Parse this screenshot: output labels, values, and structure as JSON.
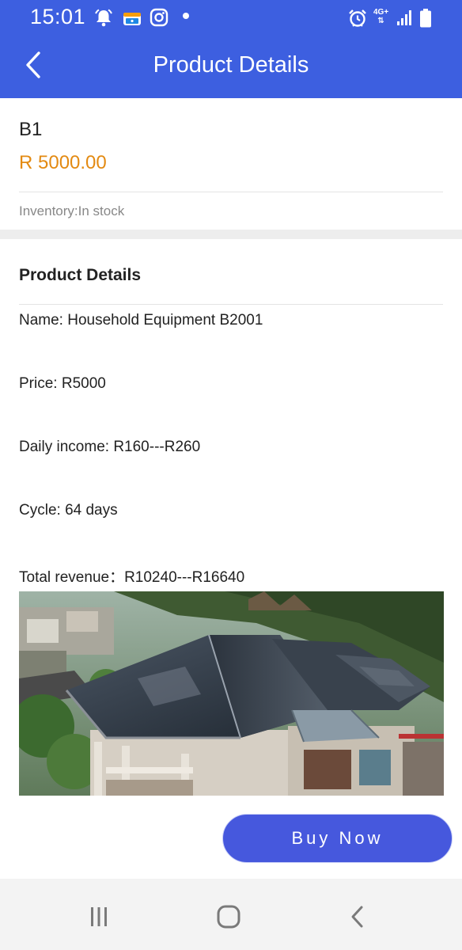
{
  "status_bar": {
    "time": "15:01",
    "network": "4G+",
    "icons": [
      "alarm-bell-icon",
      "wallet-app-icon",
      "instagram-icon",
      "notification-dot-icon",
      "alarm-clock-icon",
      "signal-icon",
      "battery-icon"
    ]
  },
  "header": {
    "title": "Product Details",
    "back_icon": "chevron-left-icon"
  },
  "summary": {
    "code": "B1",
    "price": "R 5000.00",
    "inventory": "Inventory:In stock"
  },
  "details": {
    "heading": "Product Details",
    "name": "Name: Household Equipment B2001",
    "price": "Price: R5000",
    "daily_income": "Daily income: R160---R260",
    "cycle": "Cycle: 64 days",
    "total_revenue": "Total revenue：R10240---R16640"
  },
  "buy_button": "Buy Now",
  "colors": {
    "primary": "#3d5fe0",
    "button": "#4658dd",
    "price": "#e38a12"
  },
  "nav_bar": [
    "recents-icon",
    "home-icon",
    "back-icon"
  ]
}
